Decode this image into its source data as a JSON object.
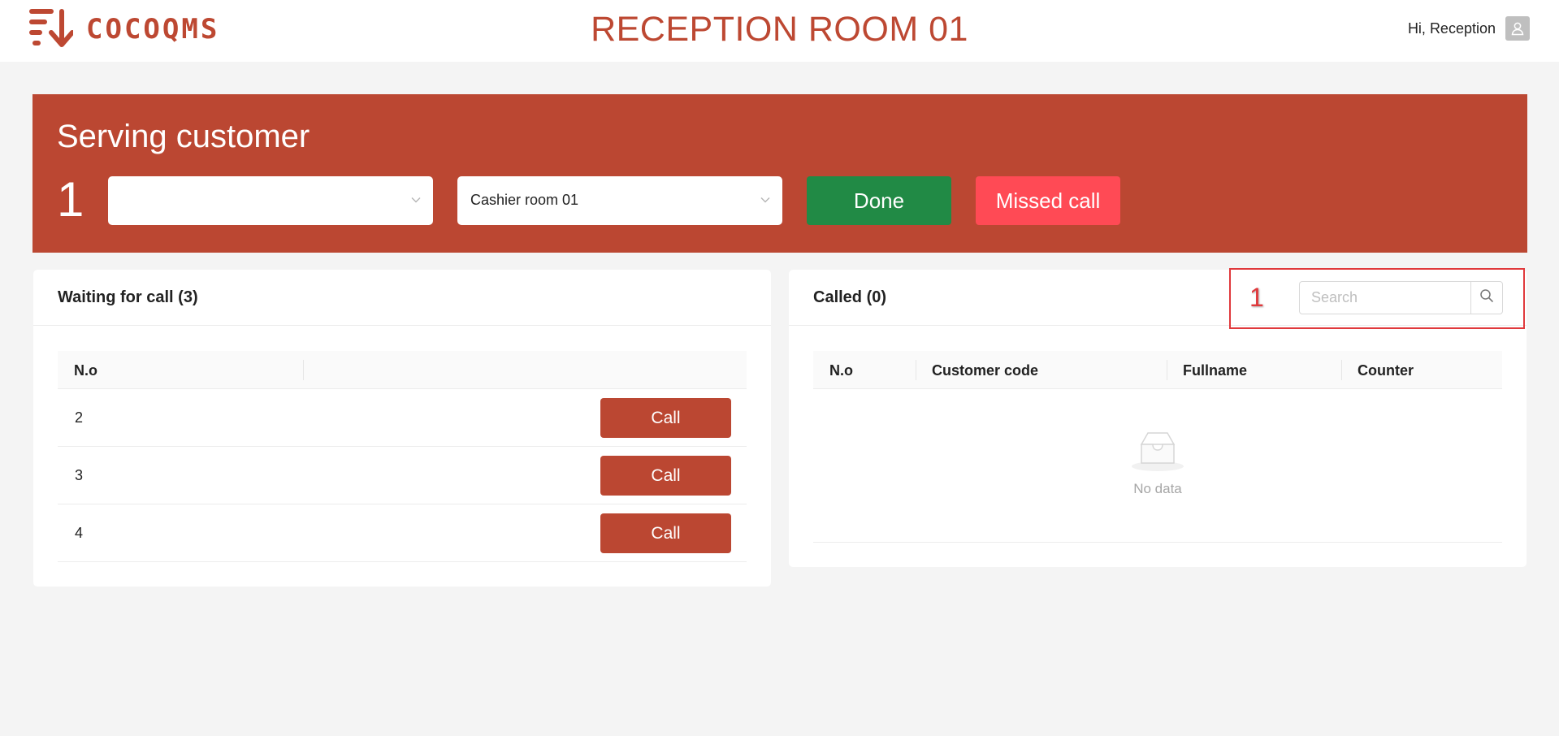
{
  "header": {
    "logo_text": "COCOQMS",
    "title": "RECEPTION ROOM 01",
    "greeting": "Hi, Reception",
    "brand_color": "#bd4832"
  },
  "serving": {
    "title": "Serving customer",
    "number": "1",
    "customer_select": {
      "value": ""
    },
    "room_select": {
      "value": "Cashier room 01"
    },
    "done_label": "Done",
    "missed_label": "Missed call",
    "colors": {
      "panel": "#bb4732",
      "done": "#218a45",
      "missed": "#ff4a55"
    }
  },
  "waiting": {
    "title": "Waiting for call (3)",
    "columns": [
      "N.o",
      ""
    ],
    "rows": [
      {
        "no": "2",
        "action": "Call"
      },
      {
        "no": "3",
        "action": "Call"
      },
      {
        "no": "4",
        "action": "Call"
      }
    ]
  },
  "called": {
    "title": "Called (0)",
    "search_placeholder": "Search",
    "columns": [
      "N.o",
      "Customer code",
      "Fullname",
      "Counter"
    ],
    "empty_text": "No data"
  },
  "annotation": {
    "label": "1",
    "color": "#e0393c"
  },
  "icons": {
    "logo": "queue-logo-icon",
    "user": "user-avatar-icon",
    "dropdown": "chevron-down-icon",
    "search": "search-icon",
    "empty": "inbox-empty-icon"
  }
}
